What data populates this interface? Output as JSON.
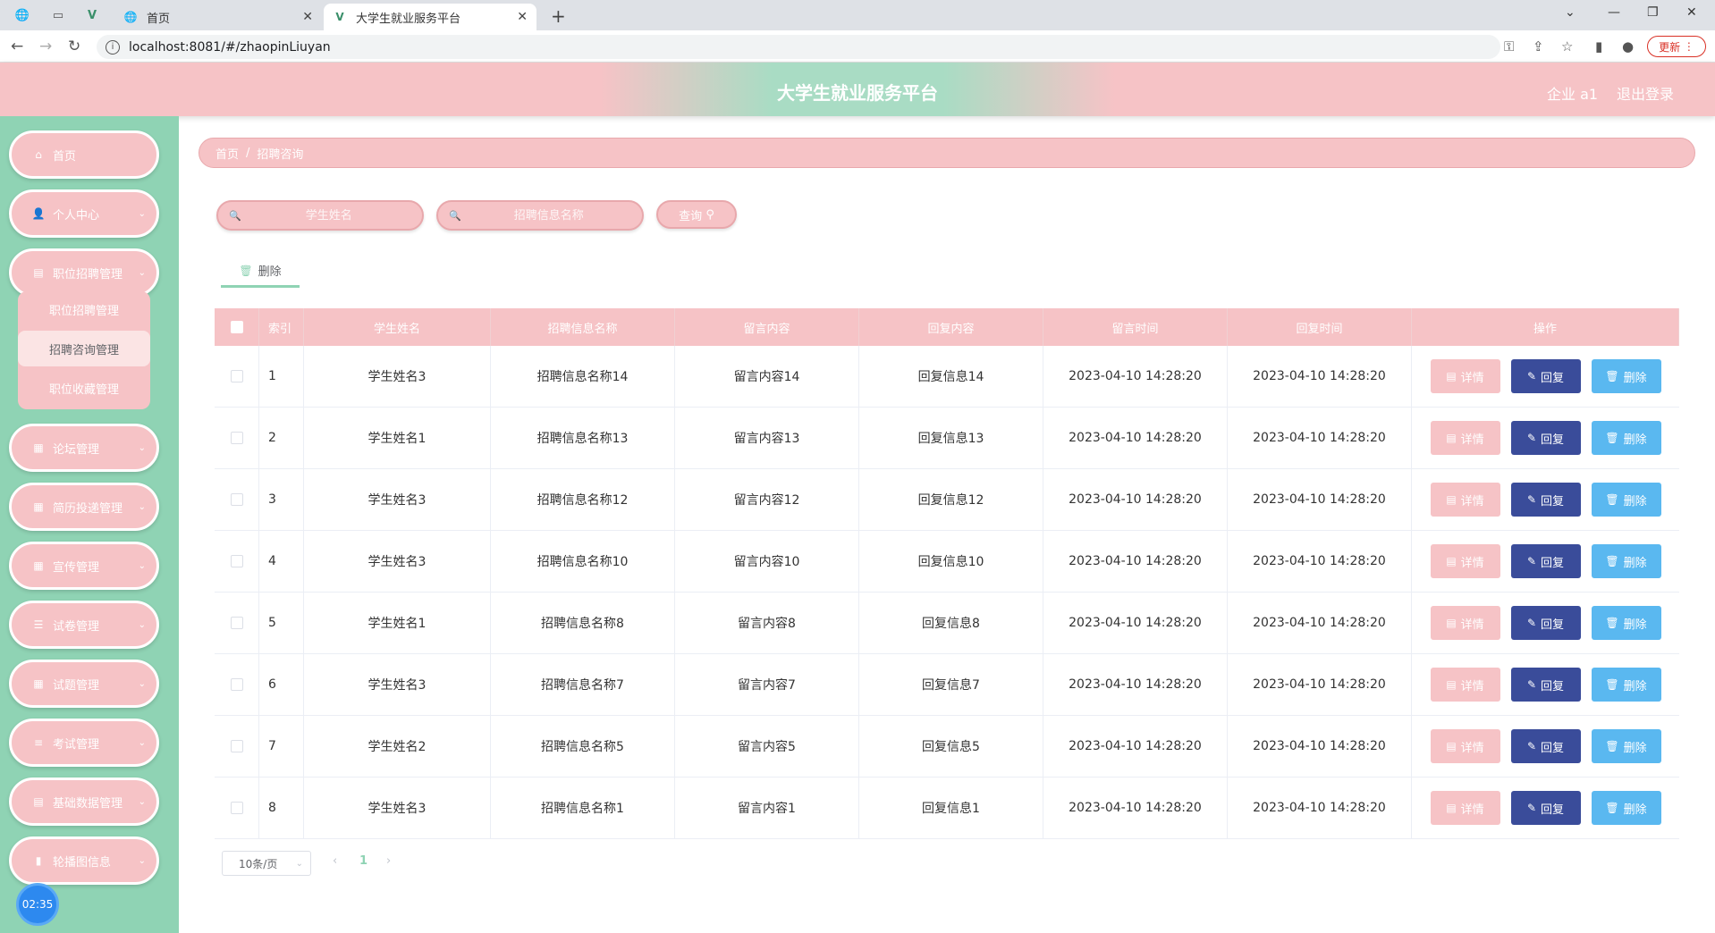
{
  "browser": {
    "tabs": [
      {
        "label": "首页",
        "active": false
      },
      {
        "label": "大学生就业服务平台",
        "active": true
      }
    ],
    "url": "localhost:8081/#/zhaopinLiuyan",
    "update_label": "更新"
  },
  "header": {
    "title": "大学生就业服务平台",
    "user": "企业 a1",
    "logout": "退出登录"
  },
  "sidebar": {
    "items": [
      {
        "label": "首页",
        "icon": "home-icon"
      },
      {
        "label": "个人中心",
        "icon": "user-icon"
      },
      {
        "label": "职位招聘管理",
        "icon": "clipboard-icon"
      },
      {
        "label": "论坛管理",
        "icon": "grid-icon"
      },
      {
        "label": "简历投递管理",
        "icon": "grid-icon"
      },
      {
        "label": "宣传管理",
        "icon": "grid-icon"
      },
      {
        "label": "试卷管理",
        "icon": "sliders-icon"
      },
      {
        "label": "试题管理",
        "icon": "grid-icon"
      },
      {
        "label": "考试管理",
        "icon": "list-icon"
      },
      {
        "label": "基础数据管理",
        "icon": "clipboard-icon"
      },
      {
        "label": "轮播图信息",
        "icon": "chart-icon"
      }
    ],
    "submenu": [
      {
        "label": "职位招聘管理",
        "active": false
      },
      {
        "label": "招聘咨询管理",
        "active": true
      },
      {
        "label": "职位收藏管理",
        "active": false
      }
    ],
    "clock": "02:35"
  },
  "breadcrumb": {
    "home": "首页",
    "sep": "/",
    "current": "招聘咨询"
  },
  "search": {
    "student_placeholder": "学生姓名",
    "info_placeholder": "招聘信息名称",
    "query_label": "查询"
  },
  "toolbar": {
    "delete_label": "删除"
  },
  "table": {
    "headers": [
      "索引",
      "学生姓名",
      "招聘信息名称",
      "留言内容",
      "回复内容",
      "留言时间",
      "回复时间",
      "操作"
    ],
    "rows": [
      {
        "idx": "1",
        "name": "学生姓名3",
        "info": "招聘信息名称14",
        "msg": "留言内容14",
        "reply": "回复信息14",
        "mtime": "2023-04-10 14:28:20",
        "rtime": "2023-04-10 14:28:20"
      },
      {
        "idx": "2",
        "name": "学生姓名1",
        "info": "招聘信息名称13",
        "msg": "留言内容13",
        "reply": "回复信息13",
        "mtime": "2023-04-10 14:28:20",
        "rtime": "2023-04-10 14:28:20"
      },
      {
        "idx": "3",
        "name": "学生姓名3",
        "info": "招聘信息名称12",
        "msg": "留言内容12",
        "reply": "回复信息12",
        "mtime": "2023-04-10 14:28:20",
        "rtime": "2023-04-10 14:28:20"
      },
      {
        "idx": "4",
        "name": "学生姓名3",
        "info": "招聘信息名称10",
        "msg": "留言内容10",
        "reply": "回复信息10",
        "mtime": "2023-04-10 14:28:20",
        "rtime": "2023-04-10 14:28:20"
      },
      {
        "idx": "5",
        "name": "学生姓名1",
        "info": "招聘信息名称8",
        "msg": "留言内容8",
        "reply": "回复信息8",
        "mtime": "2023-04-10 14:28:20",
        "rtime": "2023-04-10 14:28:20"
      },
      {
        "idx": "6",
        "name": "学生姓名3",
        "info": "招聘信息名称7",
        "msg": "留言内容7",
        "reply": "回复信息7",
        "mtime": "2023-04-10 14:28:20",
        "rtime": "2023-04-10 14:28:20"
      },
      {
        "idx": "7",
        "name": "学生姓名2",
        "info": "招聘信息名称5",
        "msg": "留言内容5",
        "reply": "回复信息5",
        "mtime": "2023-04-10 14:28:20",
        "rtime": "2023-04-10 14:28:20"
      },
      {
        "idx": "8",
        "name": "学生姓名3",
        "info": "招聘信息名称1",
        "msg": "留言内容1",
        "reply": "回复信息1",
        "mtime": "2023-04-10 14:28:20",
        "rtime": "2023-04-10 14:28:20"
      }
    ],
    "actions": {
      "detail": "详情",
      "reply": "回复",
      "delete": "删除"
    }
  },
  "pagination": {
    "page_size": "10条/页",
    "current_page": "1"
  },
  "colors": {
    "accent_pink": "#f6c3c6",
    "accent_green": "#8fd3b4",
    "reply_button": "#3a4c9a",
    "delete_button": "#5ab8f0"
  }
}
